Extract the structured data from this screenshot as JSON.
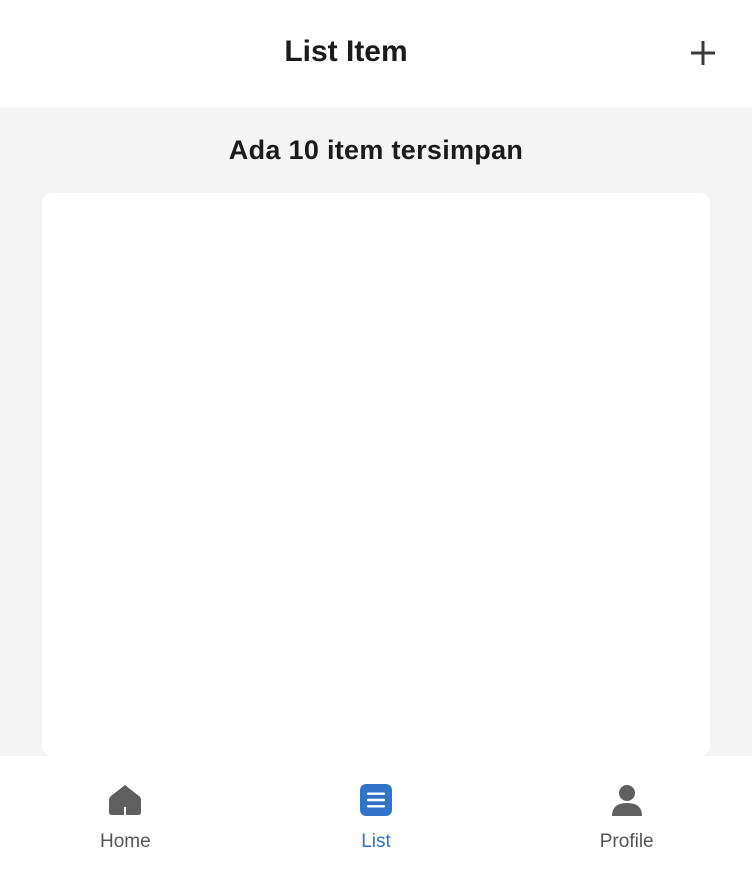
{
  "header": {
    "title": "List Item",
    "add_icon": "plus-icon"
  },
  "main": {
    "count_text": "Ada 10 item tersimpan",
    "list_items": []
  },
  "tabbar": {
    "tabs": [
      {
        "label": "Home",
        "icon": "home-icon",
        "active": false
      },
      {
        "label": "List",
        "icon": "list-icon",
        "active": true
      },
      {
        "label": "Profile",
        "icon": "person-icon",
        "active": false
      }
    ]
  },
  "colors": {
    "accent": "#2f74c9",
    "inactive": "#555555",
    "background": "#f4f4f4",
    "text": "#1b1b1b"
  }
}
